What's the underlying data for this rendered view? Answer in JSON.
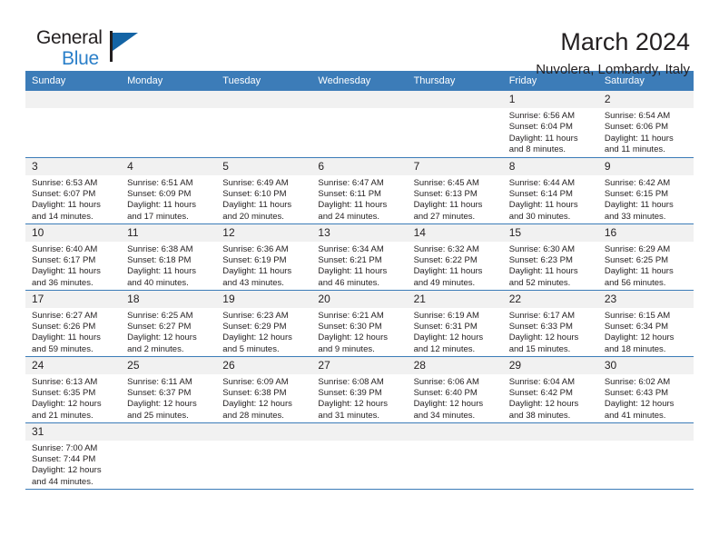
{
  "logo": {
    "name_top": "General",
    "name_bottom": "Blue",
    "flag_icon": "triangle-flag-icon",
    "brand_color": "#2a7fc9"
  },
  "header": {
    "title": "March 2024",
    "subtitle": "Nuvolera, Lombardy, Italy"
  },
  "theme": {
    "header_row_bg": "#3c7cb8",
    "daynum_bg": "#f1f1f1",
    "text": "#231f20"
  },
  "weekdays": [
    "Sunday",
    "Monday",
    "Tuesday",
    "Wednesday",
    "Thursday",
    "Friday",
    "Saturday"
  ],
  "weeks": [
    [
      {
        "day": "",
        "lines": []
      },
      {
        "day": "",
        "lines": []
      },
      {
        "day": "",
        "lines": []
      },
      {
        "day": "",
        "lines": []
      },
      {
        "day": "",
        "lines": []
      },
      {
        "day": "1",
        "lines": [
          "Sunrise: 6:56 AM",
          "Sunset: 6:04 PM",
          "Daylight: 11 hours",
          "and 8 minutes."
        ]
      },
      {
        "day": "2",
        "lines": [
          "Sunrise: 6:54 AM",
          "Sunset: 6:06 PM",
          "Daylight: 11 hours",
          "and 11 minutes."
        ]
      }
    ],
    [
      {
        "day": "3",
        "lines": [
          "Sunrise: 6:53 AM",
          "Sunset: 6:07 PM",
          "Daylight: 11 hours",
          "and 14 minutes."
        ]
      },
      {
        "day": "4",
        "lines": [
          "Sunrise: 6:51 AM",
          "Sunset: 6:09 PM",
          "Daylight: 11 hours",
          "and 17 minutes."
        ]
      },
      {
        "day": "5",
        "lines": [
          "Sunrise: 6:49 AM",
          "Sunset: 6:10 PM",
          "Daylight: 11 hours",
          "and 20 minutes."
        ]
      },
      {
        "day": "6",
        "lines": [
          "Sunrise: 6:47 AM",
          "Sunset: 6:11 PM",
          "Daylight: 11 hours",
          "and 24 minutes."
        ]
      },
      {
        "day": "7",
        "lines": [
          "Sunrise: 6:45 AM",
          "Sunset: 6:13 PM",
          "Daylight: 11 hours",
          "and 27 minutes."
        ]
      },
      {
        "day": "8",
        "lines": [
          "Sunrise: 6:44 AM",
          "Sunset: 6:14 PM",
          "Daylight: 11 hours",
          "and 30 minutes."
        ]
      },
      {
        "day": "9",
        "lines": [
          "Sunrise: 6:42 AM",
          "Sunset: 6:15 PM",
          "Daylight: 11 hours",
          "and 33 minutes."
        ]
      }
    ],
    [
      {
        "day": "10",
        "lines": [
          "Sunrise: 6:40 AM",
          "Sunset: 6:17 PM",
          "Daylight: 11 hours",
          "and 36 minutes."
        ]
      },
      {
        "day": "11",
        "lines": [
          "Sunrise: 6:38 AM",
          "Sunset: 6:18 PM",
          "Daylight: 11 hours",
          "and 40 minutes."
        ]
      },
      {
        "day": "12",
        "lines": [
          "Sunrise: 6:36 AM",
          "Sunset: 6:19 PM",
          "Daylight: 11 hours",
          "and 43 minutes."
        ]
      },
      {
        "day": "13",
        "lines": [
          "Sunrise: 6:34 AM",
          "Sunset: 6:21 PM",
          "Daylight: 11 hours",
          "and 46 minutes."
        ]
      },
      {
        "day": "14",
        "lines": [
          "Sunrise: 6:32 AM",
          "Sunset: 6:22 PM",
          "Daylight: 11 hours",
          "and 49 minutes."
        ]
      },
      {
        "day": "15",
        "lines": [
          "Sunrise: 6:30 AM",
          "Sunset: 6:23 PM",
          "Daylight: 11 hours",
          "and 52 minutes."
        ]
      },
      {
        "day": "16",
        "lines": [
          "Sunrise: 6:29 AM",
          "Sunset: 6:25 PM",
          "Daylight: 11 hours",
          "and 56 minutes."
        ]
      }
    ],
    [
      {
        "day": "17",
        "lines": [
          "Sunrise: 6:27 AM",
          "Sunset: 6:26 PM",
          "Daylight: 11 hours",
          "and 59 minutes."
        ]
      },
      {
        "day": "18",
        "lines": [
          "Sunrise: 6:25 AM",
          "Sunset: 6:27 PM",
          "Daylight: 12 hours",
          "and 2 minutes."
        ]
      },
      {
        "day": "19",
        "lines": [
          "Sunrise: 6:23 AM",
          "Sunset: 6:29 PM",
          "Daylight: 12 hours",
          "and 5 minutes."
        ]
      },
      {
        "day": "20",
        "lines": [
          "Sunrise: 6:21 AM",
          "Sunset: 6:30 PM",
          "Daylight: 12 hours",
          "and 9 minutes."
        ]
      },
      {
        "day": "21",
        "lines": [
          "Sunrise: 6:19 AM",
          "Sunset: 6:31 PM",
          "Daylight: 12 hours",
          "and 12 minutes."
        ]
      },
      {
        "day": "22",
        "lines": [
          "Sunrise: 6:17 AM",
          "Sunset: 6:33 PM",
          "Daylight: 12 hours",
          "and 15 minutes."
        ]
      },
      {
        "day": "23",
        "lines": [
          "Sunrise: 6:15 AM",
          "Sunset: 6:34 PM",
          "Daylight: 12 hours",
          "and 18 minutes."
        ]
      }
    ],
    [
      {
        "day": "24",
        "lines": [
          "Sunrise: 6:13 AM",
          "Sunset: 6:35 PM",
          "Daylight: 12 hours",
          "and 21 minutes."
        ]
      },
      {
        "day": "25",
        "lines": [
          "Sunrise: 6:11 AM",
          "Sunset: 6:37 PM",
          "Daylight: 12 hours",
          "and 25 minutes."
        ]
      },
      {
        "day": "26",
        "lines": [
          "Sunrise: 6:09 AM",
          "Sunset: 6:38 PM",
          "Daylight: 12 hours",
          "and 28 minutes."
        ]
      },
      {
        "day": "27",
        "lines": [
          "Sunrise: 6:08 AM",
          "Sunset: 6:39 PM",
          "Daylight: 12 hours",
          "and 31 minutes."
        ]
      },
      {
        "day": "28",
        "lines": [
          "Sunrise: 6:06 AM",
          "Sunset: 6:40 PM",
          "Daylight: 12 hours",
          "and 34 minutes."
        ]
      },
      {
        "day": "29",
        "lines": [
          "Sunrise: 6:04 AM",
          "Sunset: 6:42 PM",
          "Daylight: 12 hours",
          "and 38 minutes."
        ]
      },
      {
        "day": "30",
        "lines": [
          "Sunrise: 6:02 AM",
          "Sunset: 6:43 PM",
          "Daylight: 12 hours",
          "and 41 minutes."
        ]
      }
    ],
    [
      {
        "day": "31",
        "lines": [
          "Sunrise: 7:00 AM",
          "Sunset: 7:44 PM",
          "Daylight: 12 hours",
          "and 44 minutes."
        ]
      },
      {
        "day": "",
        "lines": []
      },
      {
        "day": "",
        "lines": []
      },
      {
        "day": "",
        "lines": []
      },
      {
        "day": "",
        "lines": []
      },
      {
        "day": "",
        "lines": []
      },
      {
        "day": "",
        "lines": []
      }
    ]
  ]
}
